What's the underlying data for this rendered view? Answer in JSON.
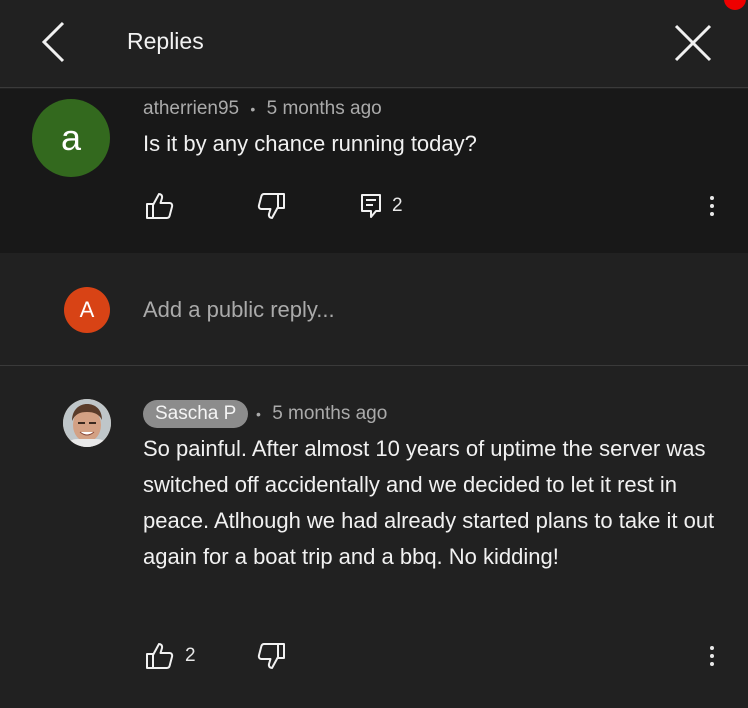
{
  "header": {
    "title": "Replies",
    "back_icon": "chevron-left-icon",
    "close_icon": "close-icon"
  },
  "parent_comment": {
    "avatar_letter": "a",
    "avatar_color": "#33691e",
    "author": "atherrien95",
    "separator": "•",
    "time": "5 months ago",
    "text": "Is it by any chance running today?",
    "like_count": "",
    "reply_count": "2"
  },
  "reply_box": {
    "avatar_letter": "A",
    "avatar_color": "#d84315",
    "placeholder": "Add a public reply..."
  },
  "replies": [
    {
      "author": "Sascha P",
      "separator": "•",
      "time": "5 months ago",
      "text": "So painful. After almost 10 years of uptime the server was switched off accidentally and we decided to let it rest in peace. Atlhough we had already started plans to take it out again for a boat trip and a bbq. No kidding!",
      "like_count": "2"
    }
  ]
}
